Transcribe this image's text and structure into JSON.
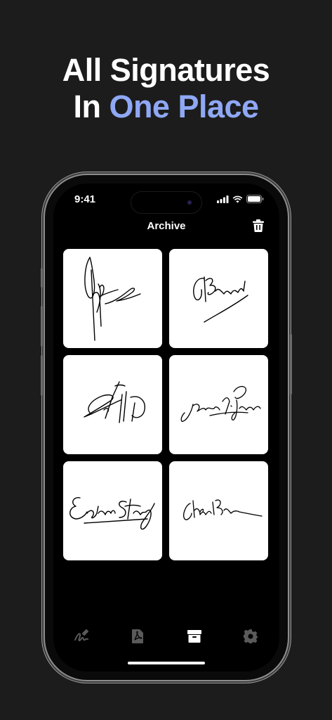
{
  "headline": {
    "line1": "All Signatures",
    "line2_prefix": "In ",
    "line2_accent": "One Place"
  },
  "status_bar": {
    "time": "9:41"
  },
  "nav": {
    "title": "Archive"
  },
  "signatures": [
    "signature-1",
    "signature-2",
    "signature-3",
    "signature-4",
    "signature-5",
    "signature-6"
  ],
  "tabbar": {
    "tabs": [
      {
        "icon": "signature-icon",
        "active": false
      },
      {
        "icon": "pdf-document-icon",
        "active": false
      },
      {
        "icon": "archive-icon",
        "active": true
      },
      {
        "icon": "gear-icon",
        "active": false
      }
    ]
  },
  "colors": {
    "background": "#1c1c1c",
    "accent": "#8fa8f5",
    "inactive_tab": "#5a5a5a"
  }
}
